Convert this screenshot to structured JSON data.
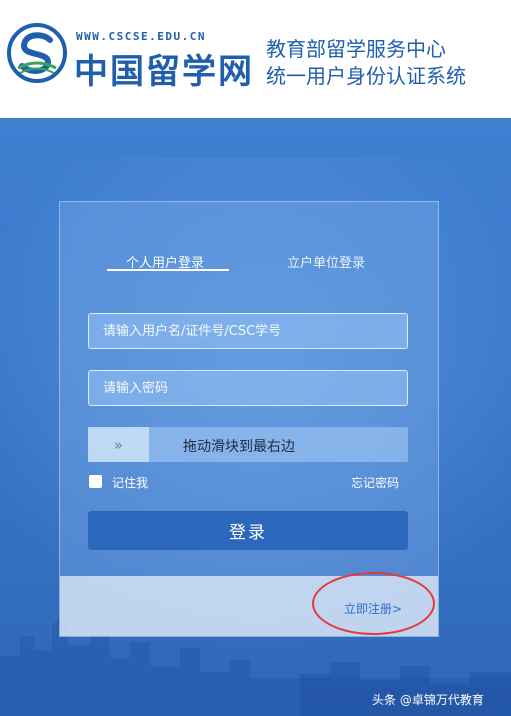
{
  "header": {
    "url_text": "WWW.CSCSE.EDU.CN",
    "site_name": "中国留学网",
    "system_title_line1": "教育部留学服务中心",
    "system_title_line2": "统一用户身份认证系统"
  },
  "login": {
    "tabs": [
      {
        "label": "个人用户登录",
        "active": true
      },
      {
        "label": "立户单位登录",
        "active": false
      }
    ],
    "username_placeholder": "请输入用户名/证件号/CSC学号",
    "password_placeholder": "请输入密码",
    "slider_handle_icon": "»",
    "slider_text": "拖动滑块到最右边",
    "remember_label": "记住我",
    "remember_checked": false,
    "forgot_label": "忘记密码",
    "login_label": "登录",
    "register_label": "立即注册>"
  },
  "watermark": "头条 @卓锦万代教育",
  "colors": {
    "brand_blue": "#1f5fae",
    "login_button": "#2b67bb",
    "highlight_red": "#e53935"
  }
}
